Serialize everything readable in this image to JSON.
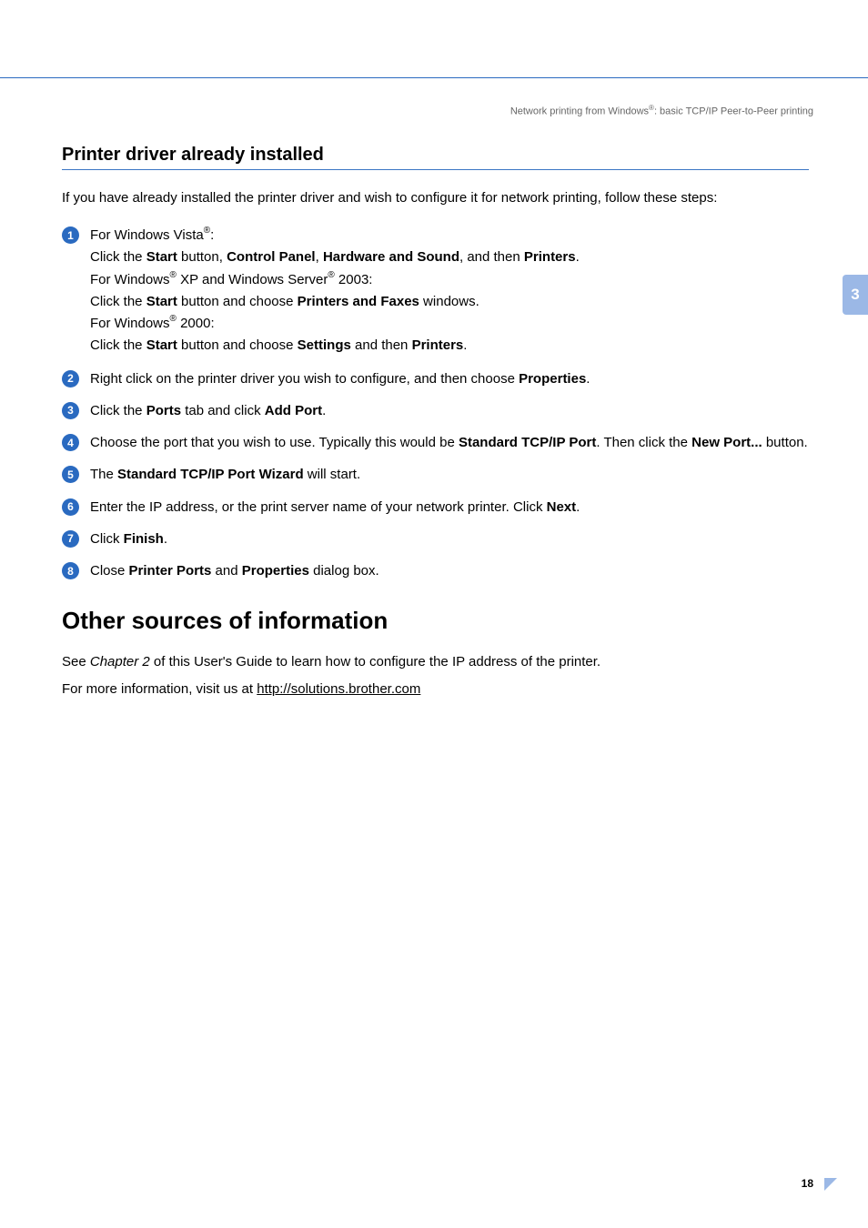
{
  "breadcrumb": {
    "pre": "Network printing from Windows",
    "sup": "®",
    "post": ": basic TCP/IP Peer-to-Peer printing"
  },
  "side_tab": "3",
  "section": {
    "title": "Printer driver already installed",
    "sub": "3",
    "intro": "If you have already installed the printer driver and wish to configure it for network printing, follow these steps:"
  },
  "steps": {
    "s1": {
      "num": "1",
      "l1a": "For Windows Vista",
      "l1b": ":",
      "l2a": "Click the ",
      "l2b": "Start",
      "l2c": " button, ",
      "l2d": "Control Panel",
      "l2e": ", ",
      "l2f": "Hardware and Sound",
      "l2g": ", and then ",
      "l2h": "Printers",
      "l2i": ".",
      "l3a": "For Windows",
      "l3b": " XP and Windows Server",
      "l3c": " 2003:",
      "l4a": "Click the ",
      "l4b": "Start",
      "l4c": " button and choose ",
      "l4d": "Printers and Faxes",
      "l4e": " windows.",
      "l5a": "For Windows",
      "l5b": " 2000:",
      "l6a": "Click the ",
      "l6b": "Start",
      "l6c": " button and choose ",
      "l6d": "Settings",
      "l6e": " and then ",
      "l6f": "Printers",
      "l6g": "."
    },
    "s2": {
      "num": "2",
      "a": "Right click on the printer driver you wish to configure, and then choose ",
      "b": "Properties",
      "c": "."
    },
    "s3": {
      "num": "3",
      "a": "Click the ",
      "b": "Ports",
      "c": " tab and click ",
      "d": "Add Port",
      "e": "."
    },
    "s4": {
      "num": "4",
      "a": "Choose the port that you wish to use. Typically this would be ",
      "b": "Standard TCP/IP Port",
      "c": ". Then click the ",
      "d": "New Port...",
      "e": " button."
    },
    "s5": {
      "num": "5",
      "a": "The ",
      "b": "Standard TCP/IP Port Wizard",
      "c": " will start."
    },
    "s6": {
      "num": "6",
      "a": "Enter the IP address, or the print server name of your network printer. Click ",
      "b": "Next",
      "c": "."
    },
    "s7": {
      "num": "7",
      "a": "Click ",
      "b": "Finish",
      "c": "."
    },
    "s8": {
      "num": "8",
      "a": "Close ",
      "b": "Printer Ports",
      "c": " and ",
      "d": "Properties",
      "e": " dialog box."
    }
  },
  "other": {
    "title": "Other sources of information",
    "sub": "3",
    "p1a": "See ",
    "p1b": "Chapter 2",
    "p1c": " of this User's Guide to learn how to configure the IP address of the printer.",
    "p2a": "For more information, visit us at ",
    "p2link": "http://solutions.brother.com"
  },
  "page_number": "18",
  "reg": "®"
}
